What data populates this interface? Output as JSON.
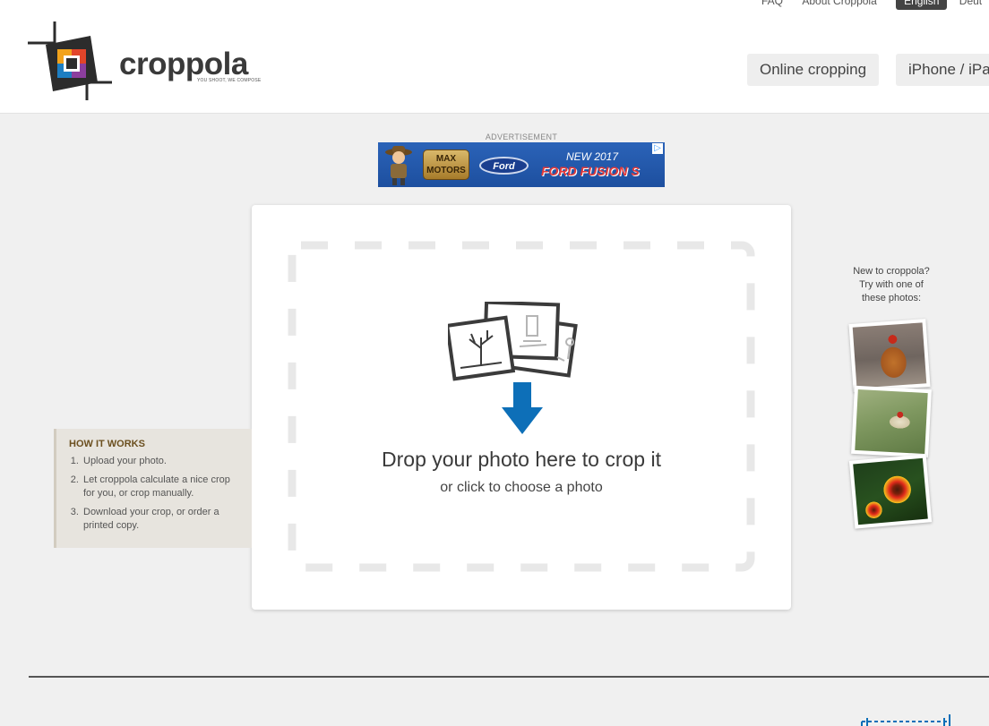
{
  "header": {
    "top_links": [
      "FAQ",
      "About Croppola"
    ],
    "languages": {
      "active": "English",
      "next": "Deut"
    },
    "logo": {
      "name": "croppola",
      "tagline": "YOU SHOOT, WE COMPOSE"
    },
    "nav": [
      "Online cropping",
      "iPhone / iPa"
    ]
  },
  "ad": {
    "label": "ADVERTISEMENT",
    "brand_text": "MAX MOTORS",
    "ford_text": "Ford",
    "headline": "NEW 2017",
    "model": "FORD FUSION S",
    "choice_icon": "ad-choices-icon"
  },
  "dropzone": {
    "title": "Drop your photo here to crop it",
    "subtitle": "or click to choose a photo",
    "accent_color": "#0d6fb8"
  },
  "how_it_works": {
    "title": "HOW IT WORKS",
    "steps": [
      "Upload your photo.",
      "Let croppola calculate a nice crop for you, or crop manually.",
      "Download your crop, or order a printed copy."
    ]
  },
  "samples": {
    "intro": [
      "New to croppola?",
      "Try with one of",
      "these photos:"
    ],
    "photos": [
      "rooster-photo",
      "bird-photo",
      "flowers-photo"
    ]
  }
}
